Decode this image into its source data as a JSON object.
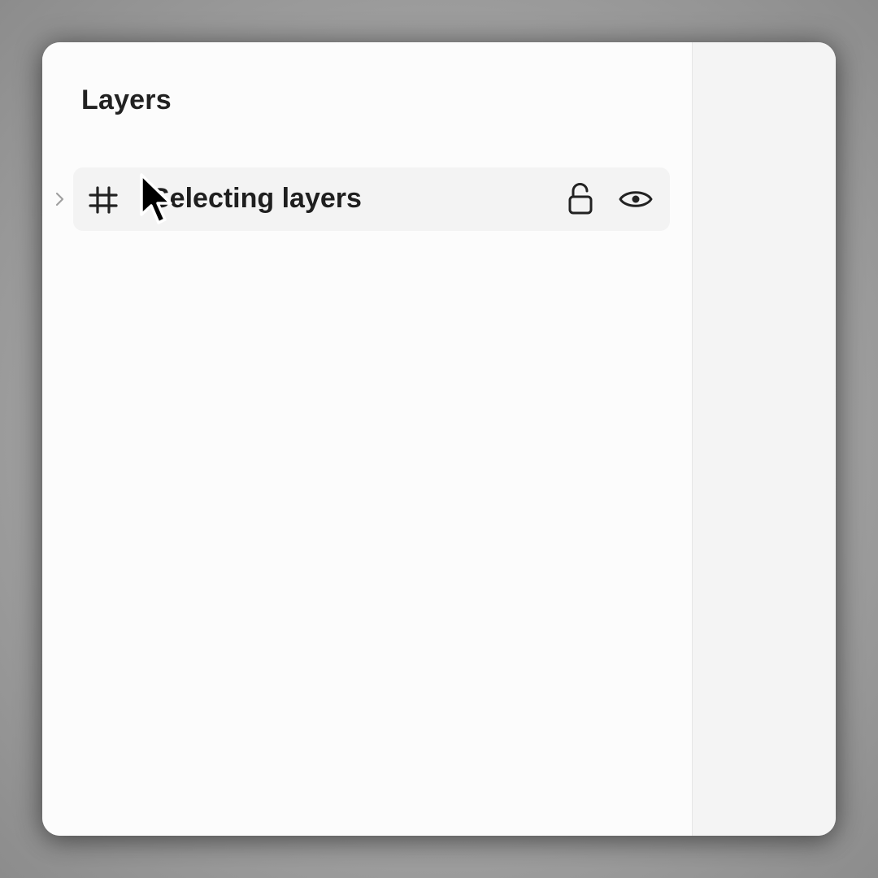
{
  "panel": {
    "title": "Layers"
  },
  "layers": [
    {
      "name": "Selecting layers",
      "type_icon": "frame-hash-icon",
      "expand_icon": "chevron-right-icon",
      "lock_icon": "unlocked-icon",
      "visibility_icon": "eye-icon",
      "hovered": true
    }
  ],
  "cursor": {
    "icon": "arrow-pointer-icon"
  },
  "colors": {
    "row_highlight": "#f3f3f3",
    "text": "#1f1f1f",
    "right_panel": "#f4f4f4"
  }
}
